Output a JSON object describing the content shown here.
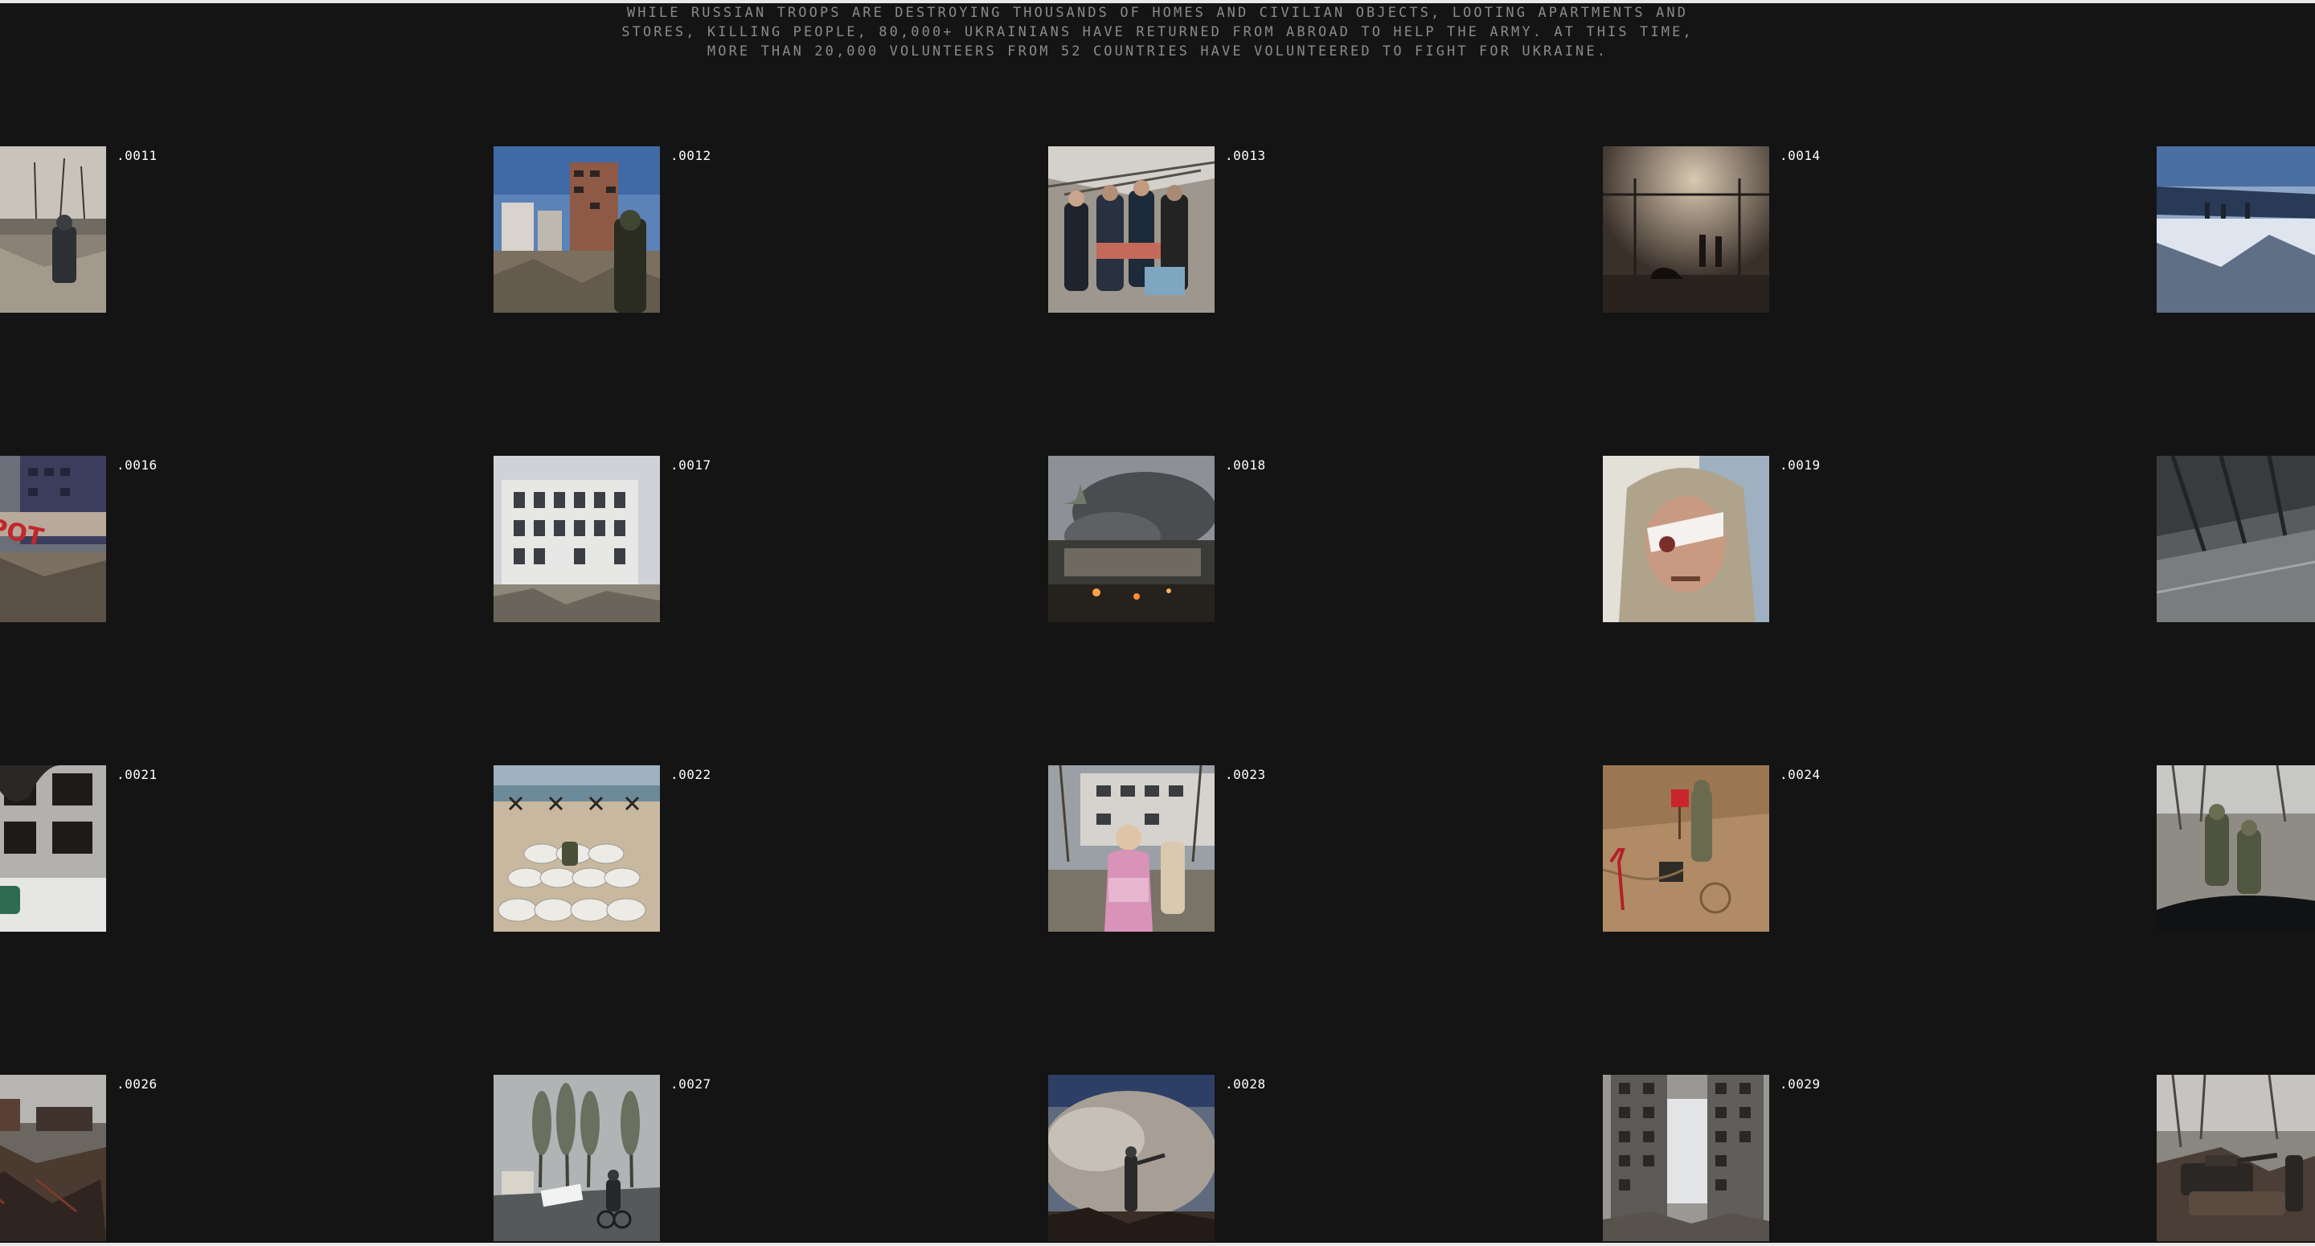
{
  "intro": {
    "lines": [
      "WHILE RUSSIAN TROOPS ARE DESTROYING THOUSANDS OF HOMES AND CIVILIAN OBJECTS, LOOTING APARTMENTS AND",
      "STORES, KILLING PEOPLE, 80,000+ UKRAINIANS HAVE RETURNED FROM ABROAD TO HELP THE ARMY. AT THIS TIME,",
      "MORE THAN 20,000 VOLUNTEERS FROM 52 COUNTRIES HAVE VOLUNTEERED TO FIGHT FOR UKRAINE."
    ]
  },
  "gallery": {
    "rows": [
      {
        "items": [
          {
            "label": ".0011",
            "scene": "ruined-street-soldier"
          },
          {
            "label": ".0012",
            "scene": "burned-highrise-soldier"
          },
          {
            "label": ".0013",
            "scene": "rescuers-carrying-injured"
          },
          {
            "label": ".0014",
            "scene": "smoke-filled-hall"
          },
          {
            "label": "",
            "scene": "collapsed-bridge-snow"
          }
        ]
      },
      {
        "items": [
          {
            "label": ".0016",
            "scene": "destroyed-mall-sign"
          },
          {
            "label": ".0017",
            "scene": "shelled-white-building"
          },
          {
            "label": ".0018",
            "scene": "smoke-over-burning-houses"
          },
          {
            "label": ".0019",
            "scene": "wounded-man-bandaged"
          },
          {
            "label": "",
            "scene": "bridge-underside"
          }
        ]
      },
      {
        "items": [
          {
            "label": ".0021",
            "scene": "burned-apartment-block"
          },
          {
            "label": ".0022",
            "scene": "sandbag-beach-position"
          },
          {
            "label": ".0023",
            "scene": "woman-fleeing-hospital"
          },
          {
            "label": ".0024",
            "scene": "deminer-mine-field"
          },
          {
            "label": "",
            "scene": "soldiers-body-bags"
          }
        ]
      },
      {
        "items": [
          {
            "label": ".0026",
            "scene": "burned-wreckage-yard"
          },
          {
            "label": ".0027",
            "scene": "cyclist-rainy-road"
          },
          {
            "label": ".0028",
            "scene": "firefighter-in-smoke"
          },
          {
            "label": ".0029",
            "scene": "collapsed-tower-block"
          },
          {
            "label": "",
            "scene": "destroyed-tanks-street"
          }
        ]
      }
    ]
  }
}
